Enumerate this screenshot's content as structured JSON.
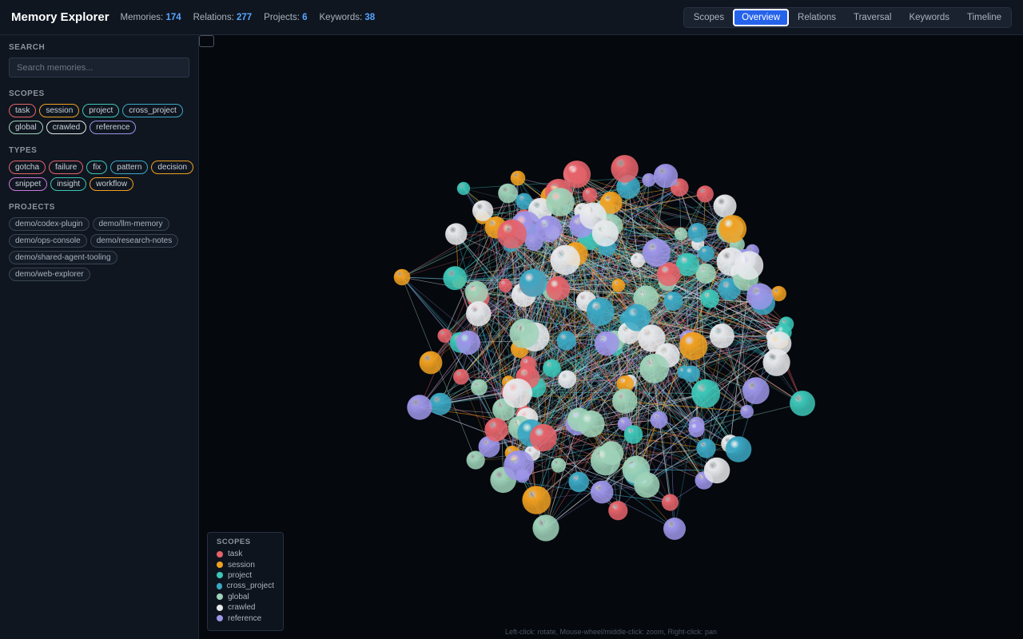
{
  "header": {
    "title": "Memory Explorer",
    "stats": [
      {
        "label": "Memories:",
        "value": "174"
      },
      {
        "label": "Relations:",
        "value": "277"
      },
      {
        "label": "Projects:",
        "value": "6"
      },
      {
        "label": "Keywords:",
        "value": "38"
      }
    ],
    "tabs": [
      "Scopes",
      "Overview",
      "Relations",
      "Traversal",
      "Keywords",
      "Timeline"
    ],
    "active_tab": "Overview"
  },
  "sidebar": {
    "search_title": "SEARCH",
    "search_placeholder": "Search memories...",
    "scopes_title": "SCOPES",
    "scopes": [
      {
        "label": "task",
        "color": "#e5636a"
      },
      {
        "label": "session",
        "color": "#f0a020"
      },
      {
        "label": "project",
        "color": "#3cc6b8"
      },
      {
        "label": "cross_project",
        "color": "#3ba8c4"
      },
      {
        "label": "global",
        "color": "#9ed2b8"
      },
      {
        "label": "crawled",
        "color": "#e6e8eb"
      },
      {
        "label": "reference",
        "color": "#9d95e8"
      }
    ],
    "types_title": "TYPES",
    "types": [
      {
        "label": "gotcha",
        "color": "#e5636a"
      },
      {
        "label": "failure",
        "color": "#e5636a"
      },
      {
        "label": "fix",
        "color": "#3cc6b8"
      },
      {
        "label": "pattern",
        "color": "#3ba8c4"
      },
      {
        "label": "decision",
        "color": "#f0a020"
      },
      {
        "label": "snippet",
        "color": "#c87adb"
      },
      {
        "label": "insight",
        "color": "#3cc6b8"
      },
      {
        "label": "workflow",
        "color": "#f0a020"
      }
    ],
    "projects_title": "PROJECTS",
    "projects": [
      "demo/codex-plugin",
      "demo/llm-memory",
      "demo/ops-console",
      "demo/research-notes",
      "demo/shared-agent-tooling",
      "demo/web-explorer"
    ]
  },
  "legend": {
    "title": "SCOPES",
    "items": [
      {
        "label": "task",
        "color": "#e5636a"
      },
      {
        "label": "session",
        "color": "#f0a020"
      },
      {
        "label": "project",
        "color": "#3cc6b8"
      },
      {
        "label": "cross_project",
        "color": "#3ba8c4"
      },
      {
        "label": "global",
        "color": "#9ed2b8"
      },
      {
        "label": "crawled",
        "color": "#e6e8eb"
      },
      {
        "label": "reference",
        "color": "#9d95e8"
      }
    ]
  },
  "hint": "Left-click: rotate, Mouse-wheel/middle-click: zoom, Right-click: pan",
  "graph": {
    "node_count": 174,
    "edge_count": 277
  }
}
